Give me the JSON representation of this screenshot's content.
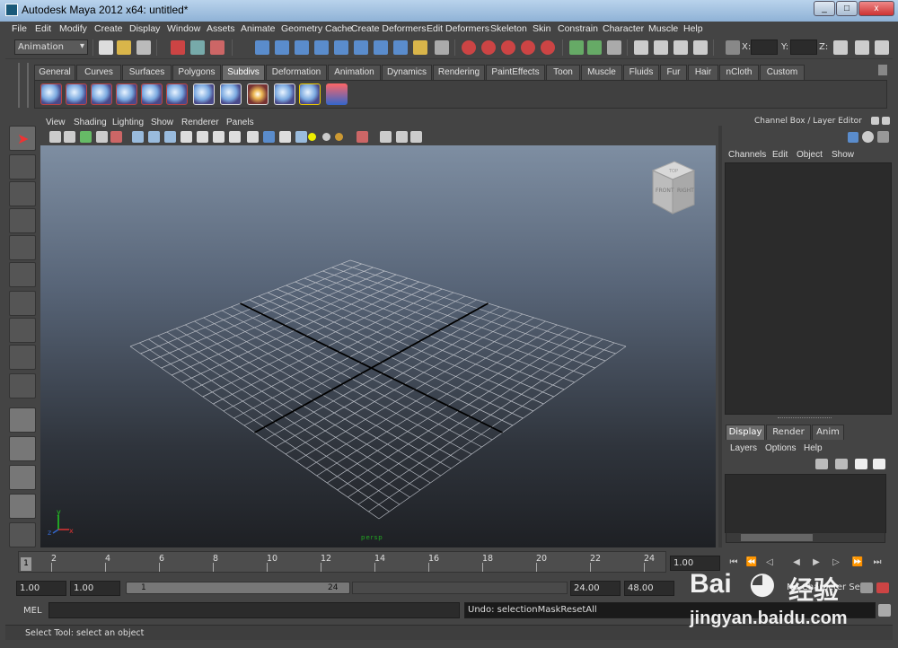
{
  "window": {
    "title": "Autodesk Maya 2012 x64: untitled*",
    "controls": [
      "_",
      "□",
      "x"
    ]
  },
  "menubar": [
    "File",
    "Edit",
    "Modify",
    "Create",
    "Display",
    "Window",
    "Assets",
    "Animate",
    "Geometry Cache",
    "Create Deformers",
    "Edit Deformers",
    "Skeleton",
    "Skin",
    "Constrain",
    "Character",
    "Muscle",
    "Help"
  ],
  "status_line": {
    "mode": "Animation",
    "x_label": "X:",
    "y_label": "Y:",
    "z_label": "Z:",
    "x_value": "",
    "y_value": "",
    "z_value": ""
  },
  "shelf_tabs": [
    "General",
    "Curves",
    "Surfaces",
    "Polygons",
    "Subdivs",
    "Deformation",
    "Animation",
    "Dynamics",
    "Rendering",
    "PaintEffects",
    "Toon",
    "Muscle",
    "Fluids",
    "Fur",
    "Hair",
    "nCloth",
    "Custom"
  ],
  "shelf_selected": "Subdivs",
  "panel_menu": [
    "View",
    "Shading",
    "Lighting",
    "Show",
    "Renderer",
    "Panels"
  ],
  "viewport": {
    "camera": "persp",
    "viewcube_front": "FRONT",
    "viewcube_right": "RIGHT",
    "viewcube_top": "TOP",
    "axis_x": "x",
    "axis_y": "y",
    "axis_z": "z"
  },
  "channel_box": {
    "title": "Channel Box / Layer Editor",
    "menu": [
      "Channels",
      "Edit",
      "Object",
      "Show"
    ]
  },
  "layer_editor": {
    "tabs": [
      "Display",
      "Render",
      "Anim"
    ],
    "selected": "Display",
    "menu": [
      "Layers",
      "Options",
      "Help"
    ]
  },
  "timeline": {
    "ticks": [
      "2",
      "4",
      "6",
      "8",
      "10",
      "12",
      "14",
      "16",
      "18",
      "20",
      "22",
      "24"
    ],
    "current_frame": "1",
    "current_time": "1.00"
  },
  "range": {
    "start": "1.00",
    "playback_start": "1.00",
    "slider_min": "1",
    "slider_max": "24",
    "playback_end": "24.00",
    "end": "48.00",
    "char_set": "No Character Set"
  },
  "command_line": {
    "label": "MEL",
    "input": "",
    "result": "Undo: selectionMaskResetAll"
  },
  "help_line": "Select Tool: select an object",
  "watermark": {
    "logo": "Bai",
    "logo2": "经验",
    "url": "jingyan.baidu.com"
  }
}
